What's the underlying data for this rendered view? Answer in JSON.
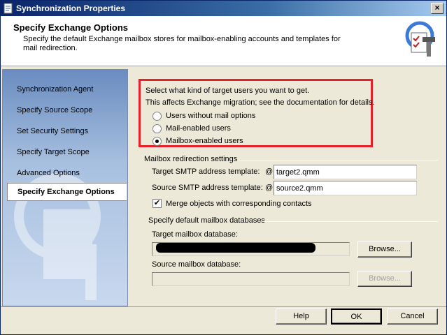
{
  "window": {
    "title": "Synchronization Properties",
    "close_glyph": "×"
  },
  "header": {
    "title": "Specify Exchange Options",
    "description": "Specify the default Exchange mailbox stores for mailbox-enabling accounts and templates for mail redirection.",
    "icon": "wizard-tools-icon"
  },
  "sidebar": {
    "items": [
      {
        "label": "Synchronization Agent"
      },
      {
        "label": "Specify Source Scope"
      },
      {
        "label": "Set Security Settings"
      },
      {
        "label": "Specify Target Scope"
      },
      {
        "label": "Advanced Options"
      },
      {
        "label": "Specify Exchange Options"
      }
    ],
    "active_index": 5
  },
  "target_users": {
    "prompt": "Select what kind of target users you want to get.",
    "note": "This affects Exchange migration; see the documentation for details.",
    "options": [
      {
        "label": "Users without mail options",
        "selected": false
      },
      {
        "label": "Mail-enabled users",
        "selected": false
      },
      {
        "label": "Mailbox-enabled users",
        "selected": true
      }
    ],
    "highlight_color": "#e8202a"
  },
  "redirection": {
    "group_label": "Mailbox redirection settings",
    "target_label": "Target SMTP address template:",
    "target_at": "@",
    "target_value": "target2.qmm",
    "source_label": "Source SMTP address template:",
    "source_at": "@",
    "source_value": "source2.qmm",
    "merge_label": "Merge objects with corresponding contacts",
    "merge_checked": true,
    "check_glyph": "✔"
  },
  "databases": {
    "group_label": "Specify default mailbox databases",
    "target_label": "Target mailbox database:",
    "target_browse": "Browse...",
    "source_label": "Source mailbox database:",
    "source_browse": "Browse..."
  },
  "footer": {
    "help": "Help",
    "ok": "OK",
    "cancel": "Cancel"
  }
}
